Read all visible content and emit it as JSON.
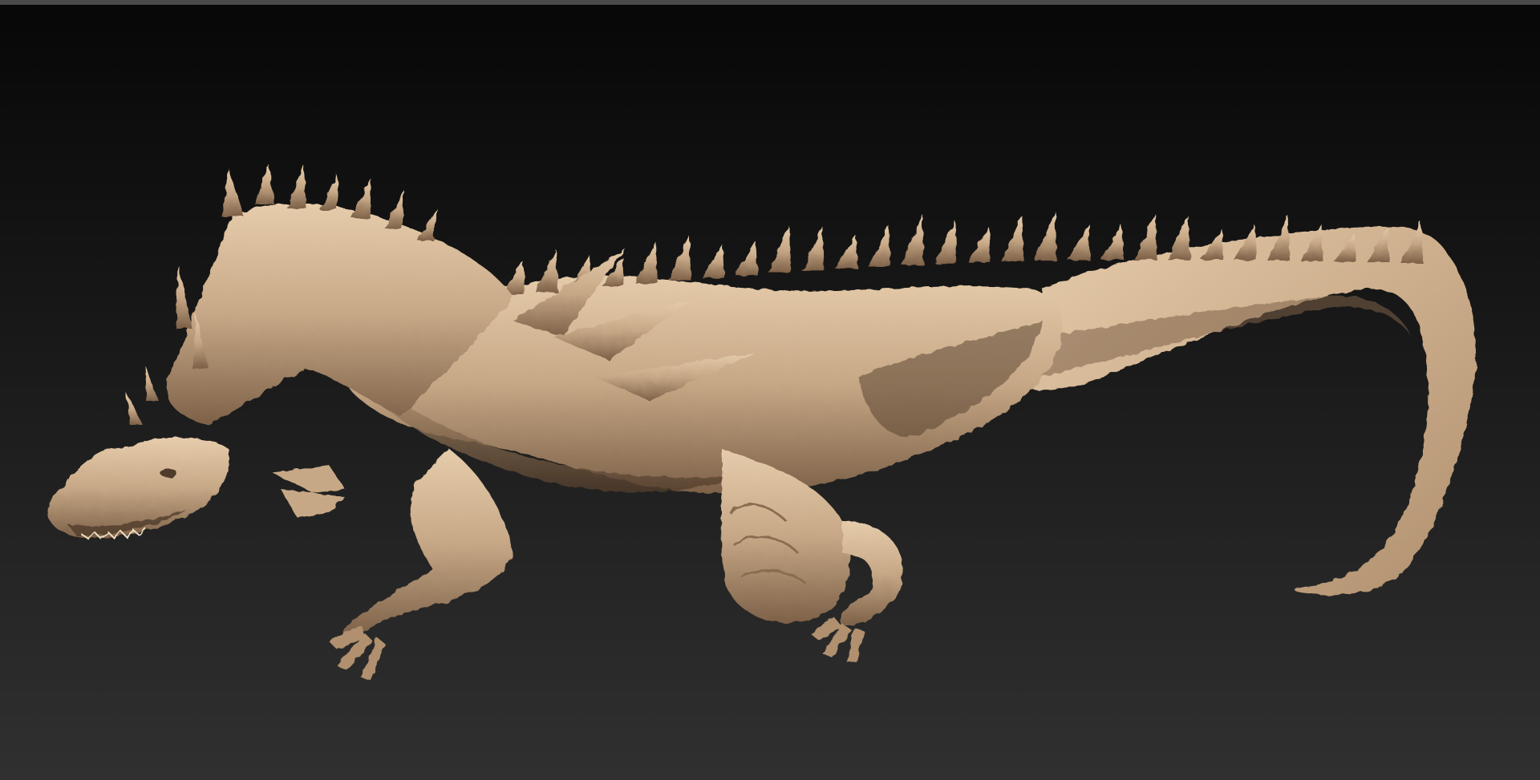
{
  "viewport": {
    "background_top": "#070707",
    "background_bottom": "#303030",
    "top_strip": "#4a4a4a"
  },
  "sculpt": {
    "material_base": "#c7a886",
    "material_light": "#e6ccab",
    "material_mid": "#b0906e",
    "material_shadow": "#7d6148",
    "material_deep": "#4f3b2a"
  }
}
